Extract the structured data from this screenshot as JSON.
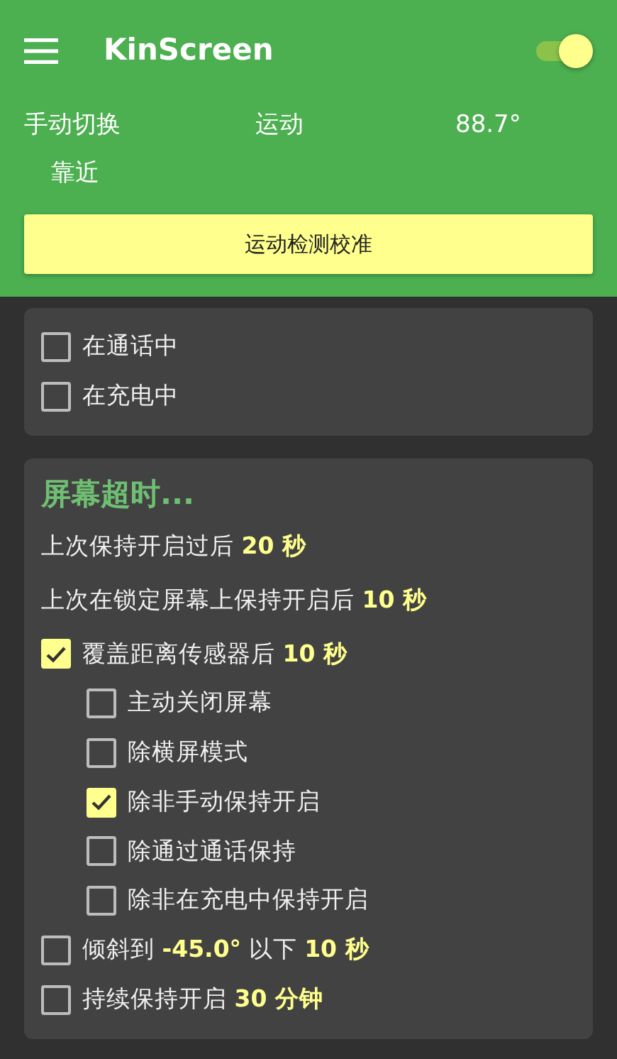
{
  "app_bar": {
    "title": "KinScreen",
    "switch": {
      "on": true
    }
  },
  "status": {
    "mode": "手动切换",
    "motion": "运动",
    "angle": "88.7°",
    "proximity": "靠近"
  },
  "calibrate_button": "运动检测校准",
  "keep_on_card": {
    "options": [
      {
        "label": "在通话中",
        "checked": false
      },
      {
        "label": "在充电中",
        "checked": false
      }
    ]
  },
  "timeout_card": {
    "title": "屏幕超时...",
    "items": [
      {
        "kind": "text",
        "label": "上次保持开启过后 **20 秒**"
      },
      {
        "kind": "text",
        "label": "上次在锁定屏幕上保持开启后 **10 秒**"
      },
      {
        "kind": "checkbox",
        "label": "覆盖距离传感器后 **10 秒**",
        "checked": true,
        "children": [
          {
            "kind": "checkbox",
            "label": "主动关闭屏幕",
            "checked": false
          },
          {
            "kind": "checkbox",
            "label": "除横屏模式",
            "checked": false
          },
          {
            "kind": "checkbox",
            "label": "除非手动保持开启",
            "checked": true
          },
          {
            "kind": "checkbox",
            "label": "除通过通话保持",
            "checked": false
          },
          {
            "kind": "checkbox",
            "label": "除非在充电中保持开启",
            "checked": false
          }
        ]
      },
      {
        "kind": "checkbox",
        "label": "倾斜到 **-45.0°** 以下 **10 秒**",
        "checked": false
      },
      {
        "kind": "checkbox",
        "label": "持续保持开启 **30 分钟**",
        "checked": false
      }
    ]
  }
}
